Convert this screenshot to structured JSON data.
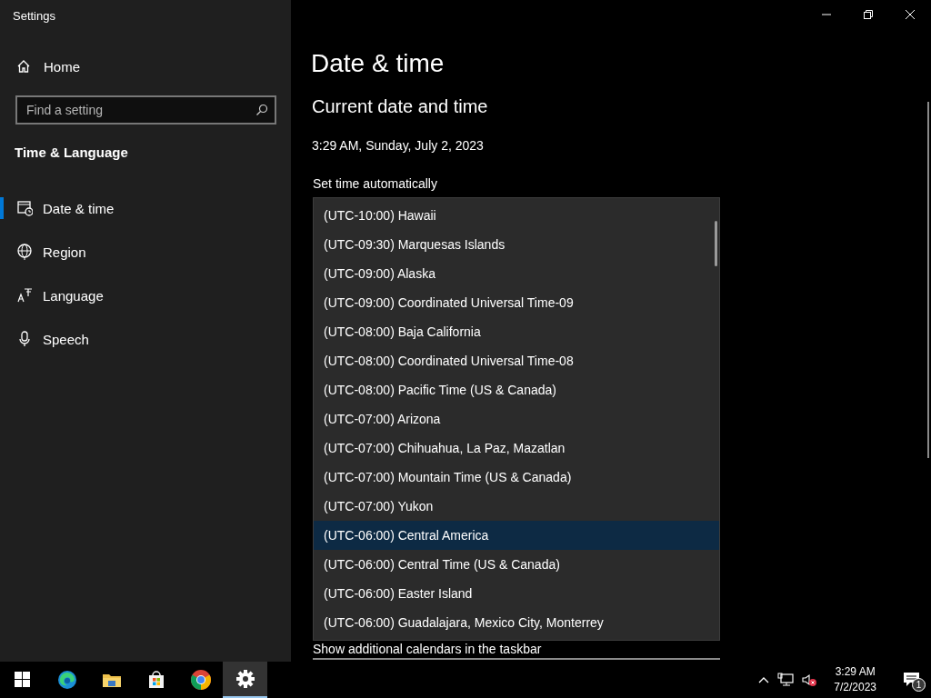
{
  "window": {
    "title": "Settings"
  },
  "sidebar": {
    "home": "Home",
    "search": {
      "placeholder": "Find a setting"
    },
    "section": "Time & Language",
    "items": [
      {
        "label": "Date & time",
        "kind": "calendar",
        "selected": true
      },
      {
        "label": "Region",
        "kind": "globe",
        "selected": false
      },
      {
        "label": "Language",
        "kind": "language",
        "selected": false
      },
      {
        "label": "Speech",
        "kind": "microphone",
        "selected": false
      }
    ]
  },
  "main": {
    "title": "Date & time",
    "heading": "Current date and time",
    "current": "3:29 AM, Sunday, July 2, 2023",
    "set_time_label": "Set time automatically",
    "calendars_label": "Show additional calendars in the taskbar"
  },
  "timezone_dropdown": {
    "options": [
      {
        "label": "(UTC-10:00) Hawaii",
        "selected": false
      },
      {
        "label": "(UTC-09:30) Marquesas Islands",
        "selected": false
      },
      {
        "label": "(UTC-09:00) Alaska",
        "selected": false
      },
      {
        "label": "(UTC-09:00) Coordinated Universal Time-09",
        "selected": false
      },
      {
        "label": "(UTC-08:00) Baja California",
        "selected": false
      },
      {
        "label": "(UTC-08:00) Coordinated Universal Time-08",
        "selected": false
      },
      {
        "label": "(UTC-08:00) Pacific Time (US & Canada)",
        "selected": false
      },
      {
        "label": "(UTC-07:00) Arizona",
        "selected": false
      },
      {
        "label": "(UTC-07:00) Chihuahua, La Paz, Mazatlan",
        "selected": false
      },
      {
        "label": "(UTC-07:00) Mountain Time (US & Canada)",
        "selected": false
      },
      {
        "label": "(UTC-07:00) Yukon",
        "selected": false
      },
      {
        "label": "(UTC-06:00) Central America",
        "selected": true
      },
      {
        "label": "(UTC-06:00) Central Time (US & Canada)",
        "selected": false
      },
      {
        "label": "(UTC-06:00) Easter Island",
        "selected": false
      },
      {
        "label": "(UTC-06:00) Guadalajara, Mexico City, Monterrey",
        "selected": false
      }
    ]
  },
  "taskbar": {
    "apps": [
      {
        "kind": "start",
        "active": false
      },
      {
        "kind": "edge",
        "active": false
      },
      {
        "kind": "folder",
        "active": false
      },
      {
        "kind": "store",
        "active": false
      },
      {
        "kind": "chrome",
        "active": false
      },
      {
        "kind": "settings",
        "active": true
      }
    ],
    "time": "3:29 AM",
    "date": "7/2/2023",
    "notifications": "1"
  }
}
